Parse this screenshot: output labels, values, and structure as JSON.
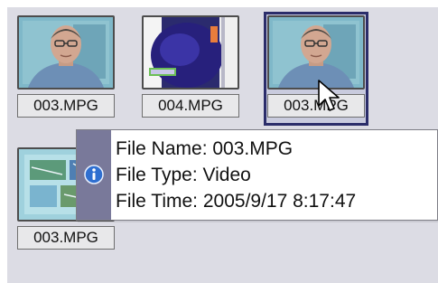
{
  "files": [
    {
      "name": "003.MPG",
      "thumbnail": "man-portrait-thumbnail",
      "selected": false
    },
    {
      "name": "004.MPG",
      "thumbnail": "dark-blue-video-frame-thumbnail",
      "selected": false
    },
    {
      "name": "003.MPG",
      "thumbnail": "man-portrait-thumbnail",
      "selected": true
    },
    {
      "name": "003.MPG",
      "thumbnail": "map-frame-thumbnail",
      "selected": false
    }
  ],
  "tooltip": {
    "file_name_line": "File Name: 003.MPG",
    "file_type_line": "File Type: Video",
    "file_time_line": "File Time: 2005/9/17 8:17:47",
    "icon": "info-icon"
  },
  "colors": {
    "panel_background": "#dcdce4",
    "selection_border": "#2b2d6a",
    "tooltip_strip": "#79799a",
    "info_icon": "#2f6fd0"
  }
}
